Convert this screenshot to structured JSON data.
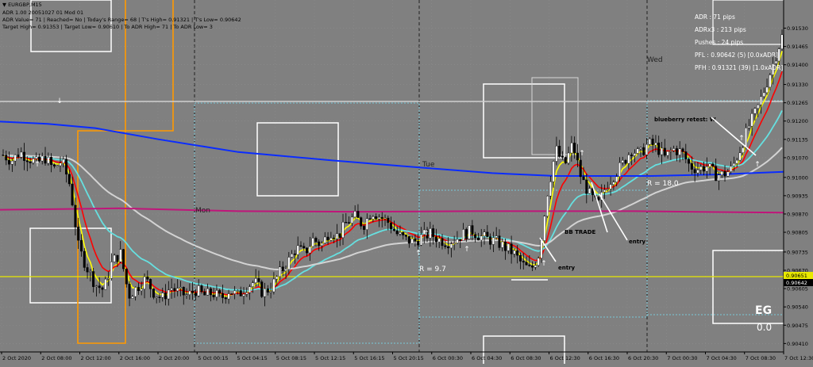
{
  "header": {
    "symbol": "EURGBP,M15",
    "line1": "ADR 1.00 20051027 01 Mod 01",
    "line2": "ADR Value= 71   |   Reached= No   |   Today's Range= 68   |   T's High= 0.91321   |   T's Low= 0.90642",
    "line3": "Target High= 0.91353   |   Target Low= 0.90610   |   To ADR High= 71   |   To ADR Low= 3"
  },
  "stats": {
    "adr": "ADR : 71 pips",
    "adrx3": "ADRx3 : 213 pips",
    "pushes": "Pushes : 24 pips",
    "pfl": "PFL : 0.90642 (5) [0.0xADR]",
    "pfh": "PFH : 0.91321 (39) [1.0xADR]"
  },
  "badge": {
    "name": "EG",
    "value": "0.0"
  },
  "price_tags": {
    "upper": "0.90651",
    "lower": "0.90642"
  },
  "colors": {
    "background": "#808080",
    "bull_candle": "#ffffff",
    "bear_candle": "#000000",
    "ema_yellow": "#ffff00",
    "ema_red": "#ff0000",
    "ma_cyan": "#66e0e0",
    "ma_gray": "#d3d3d3",
    "ma_blue": "#0a2cff",
    "ma_magenta": "#c0157a",
    "support_yellow": "#e8e800",
    "adr_orange": "#ff9900"
  },
  "chart_data": {
    "type": "candlestick",
    "y_ticks": [
      "0.91530",
      "0.91465",
      "0.91400",
      "0.91330",
      "0.91265",
      "0.91200",
      "0.91135",
      "0.91070",
      "0.91000",
      "0.90935",
      "0.90870",
      "0.90805",
      "0.90735",
      "0.90670",
      "0.90605",
      "0.90540",
      "0.90475",
      "0.90410"
    ],
    "x_ticks": [
      "2 Oct 2020",
      "2 Oct 08:00",
      "2 Oct 12:00",
      "2 Oct 16:00",
      "2 Oct 20:00",
      "5 Oct 00:15",
      "5 Oct 04:15",
      "5 Oct 08:15",
      "5 Oct 12:15",
      "5 Oct 16:15",
      "5 Oct 20:15",
      "6 Oct 00:30",
      "6 Oct 04:30",
      "6 Oct 08:30",
      "6 Oct 12:30",
      "6 Oct 16:30",
      "6 Oct 20:30",
      "7 Oct 00:30",
      "7 Oct 04:30",
      "7 Oct 08:30",
      "7 Oct 12:30"
    ],
    "ylim": [
      0.9038,
      0.9163
    ],
    "session_labels": [
      "Mon",
      "Tue",
      "Wed"
    ],
    "annotations": [
      "blueberry retest: W",
      "R = 18.0",
      "BB TRADE",
      "entry",
      "entry",
      "R = 9.7"
    ],
    "close_path": [
      0.9108,
      0.9106,
      0.9109,
      0.9107,
      0.9105,
      0.9107,
      0.9103,
      0.9106,
      0.9097,
      0.9075,
      0.9068,
      0.9062,
      0.906,
      0.907,
      0.9073,
      0.9058,
      0.9061,
      0.9064,
      0.9059,
      0.9057,
      0.9061,
      0.9059,
      0.9058,
      0.906,
      0.9058,
      0.9059,
      0.9057,
      0.906,
      0.9058,
      0.9061,
      0.9063,
      0.9059,
      0.9061,
      0.9066,
      0.907,
      0.9075,
      0.9073,
      0.9078,
      0.9076,
      0.9081,
      0.9079,
      0.9084,
      0.9086,
      0.9083,
      0.9088,
      0.9086,
      0.9084,
      0.908,
      0.9078,
      0.9077,
      0.9079,
      0.908,
      0.9078,
      0.9077,
      0.9078,
      0.908,
      0.9081,
      0.9079,
      0.9078,
      0.9077,
      0.9075,
      0.9073,
      0.9069,
      0.9067,
      0.9073,
      0.9095,
      0.911,
      0.9104,
      0.9112,
      0.91,
      0.9094,
      0.909,
      0.9097,
      0.9101,
      0.9105,
      0.911,
      0.9108,
      0.9112,
      0.9111,
      0.9107,
      0.911,
      0.9109,
      0.9104,
      0.9103,
      0.9104,
      0.9101,
      0.9101,
      0.9103,
      0.911,
      0.9118,
      0.9124,
      0.9132,
      0.9141,
      0.915
    ]
  }
}
